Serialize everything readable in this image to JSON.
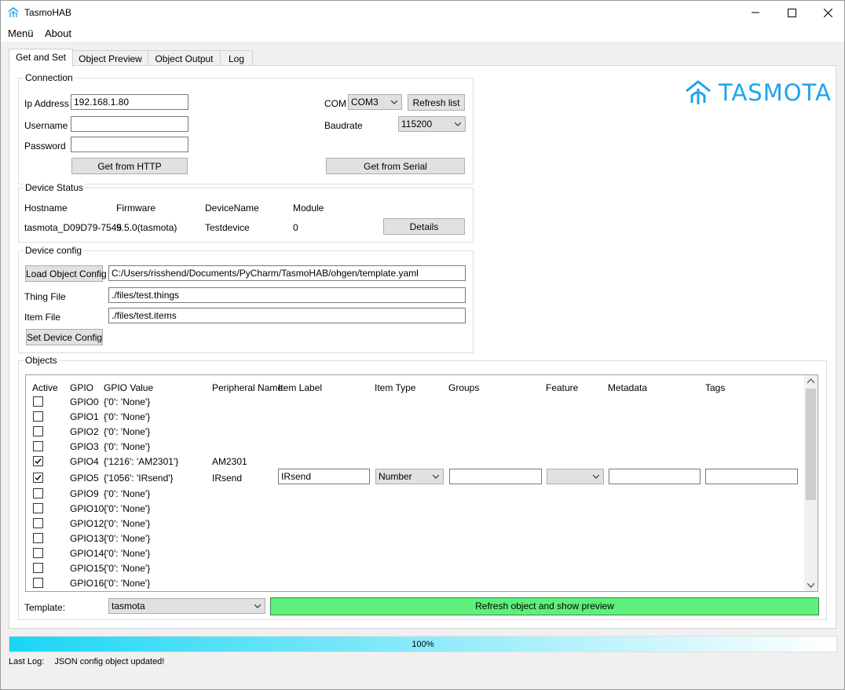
{
  "window": {
    "title": "TasmoHAB",
    "icon": "tasmota-house-icon",
    "controls": {
      "minimize": "minimize-icon",
      "maximize": "maximize-icon",
      "close": "close-icon"
    }
  },
  "menubar": {
    "items": [
      "Menü",
      "About"
    ]
  },
  "tabs": [
    "Get and Set",
    "Object Preview",
    "Object Output",
    "Log"
  ],
  "active_tab": "Get and Set",
  "logo": {
    "text": "TASMOTA",
    "color": "#1fa3ec"
  },
  "connection": {
    "title": "Connection",
    "ip_label": "Ip Address",
    "ip_value": "192.168.1.80",
    "username_label": "Username",
    "username_value": "",
    "password_label": "Password",
    "password_value": "",
    "get_http_button": "Get from HTTP",
    "com_label": "COM",
    "com_value": "COM3",
    "refresh_list_button": "Refresh list",
    "baudrate_label": "Baudrate",
    "baudrate_value": "115200",
    "get_serial_button": "Get from Serial"
  },
  "device_status": {
    "title": "Device Status",
    "headers": [
      "Hostname",
      "Firmware",
      "DeviceName",
      "Module"
    ],
    "values": [
      "tasmota_D09D79-7545",
      "9.5.0(tasmota)",
      "Testdevice",
      "0"
    ],
    "details_button": "Details"
  },
  "device_config": {
    "title": "Device config",
    "load_button": "Load Object Config",
    "config_path": "C:/Users/risshend/Documents/PyCharm/TasmoHAB/ohgen/template.yaml",
    "thing_label": "Thing File",
    "thing_value": "./files/test.things",
    "item_label": "Item File",
    "item_value": "./files/test.items",
    "set_button": "Set Device Config"
  },
  "objects": {
    "title": "Objects",
    "columns": [
      "Active",
      "GPIO",
      "GPIO Value",
      "Peripheral Name",
      "Item Label",
      "Item Type",
      "Groups",
      "Feature",
      "Metadata",
      "Tags"
    ],
    "rows": [
      {
        "active": false,
        "gpio": "GPIO0",
        "value": "{'0': 'None'}",
        "peripheral": ""
      },
      {
        "active": false,
        "gpio": "GPIO1",
        "value": "{'0': 'None'}",
        "peripheral": ""
      },
      {
        "active": false,
        "gpio": "GPIO2",
        "value": "{'0': 'None'}",
        "peripheral": ""
      },
      {
        "active": false,
        "gpio": "GPIO3",
        "value": "{'0': 'None'}",
        "peripheral": ""
      },
      {
        "active": true,
        "gpio": "GPIO4",
        "value": "{'1216': 'AM2301'}",
        "peripheral": "AM2301"
      },
      {
        "active": true,
        "gpio": "GPIO5",
        "value": "{'1056': 'IRsend'}",
        "peripheral": "IRsend",
        "item_label": "IRsend",
        "item_type": "Number",
        "groups": "",
        "feature": "",
        "metadata": "",
        "tags": ""
      },
      {
        "active": false,
        "gpio": "GPIO9",
        "value": "{'0': 'None'}",
        "peripheral": ""
      },
      {
        "active": false,
        "gpio": "GPIO10",
        "value": "{'0': 'None'}",
        "peripheral": ""
      },
      {
        "active": false,
        "gpio": "GPIO12",
        "value": "{'0': 'None'}",
        "peripheral": ""
      },
      {
        "active": false,
        "gpio": "GPIO13",
        "value": "{'0': 'None'}",
        "peripheral": ""
      },
      {
        "active": false,
        "gpio": "GPIO14",
        "value": "{'0': 'None'}",
        "peripheral": ""
      },
      {
        "active": false,
        "gpio": "GPIO15",
        "value": "{'0': 'None'}",
        "peripheral": ""
      },
      {
        "active": false,
        "gpio": "GPIO16",
        "value": "{'0': 'None'}",
        "peripheral": ""
      }
    ],
    "template_label": "Template:",
    "template_value": "tasmota",
    "refresh_button": "Refresh object and show preview",
    "refresh_button_color": "#5ef07a"
  },
  "progress": {
    "value": 1.0,
    "text": "100%",
    "color_start": "#19d6f5",
    "color_end": "#ffffff"
  },
  "status": {
    "label": "Last Log:",
    "message": "JSON config object updated!"
  }
}
